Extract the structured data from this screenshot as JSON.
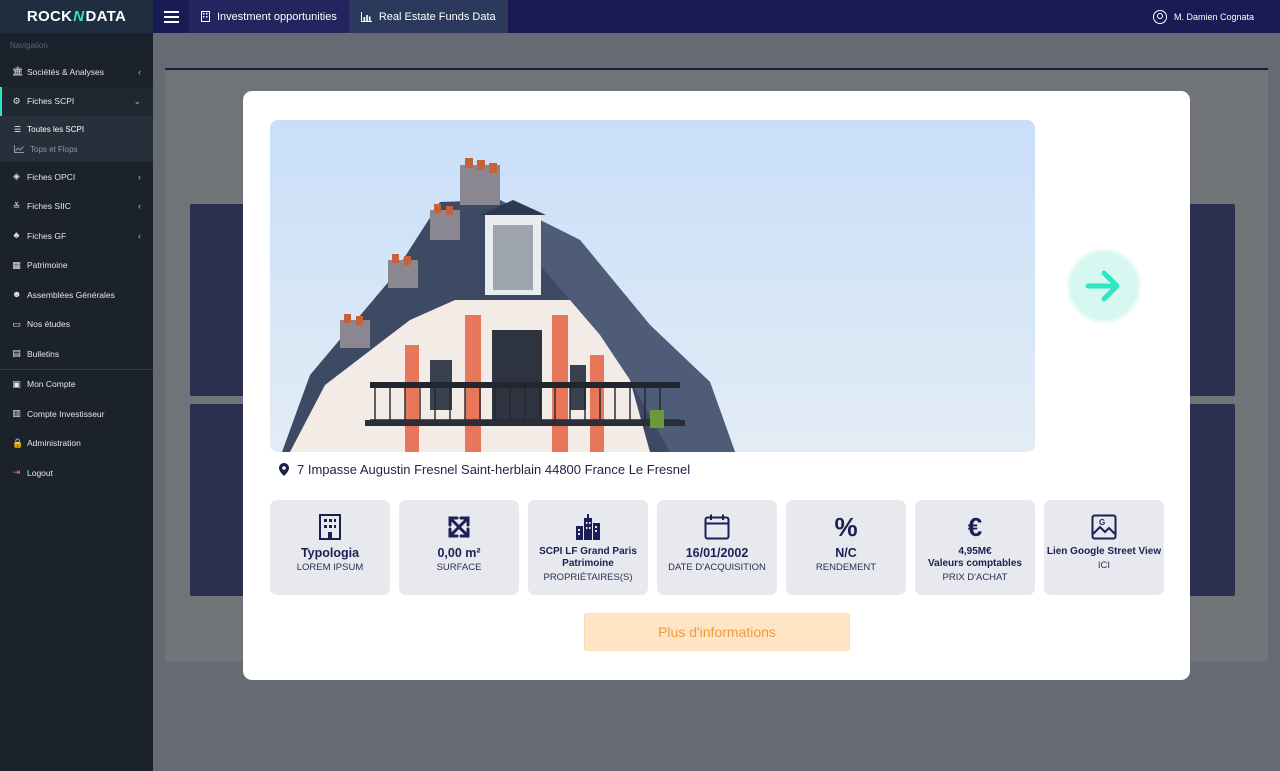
{
  "brand": {
    "left": "ROCK",
    "mid": "N",
    "right": "DATA"
  },
  "topnav": {
    "items": [
      {
        "label": "Investment opportunities",
        "icon": "building-icon"
      },
      {
        "label": "Real Estate Funds Data",
        "icon": "chart-icon"
      }
    ],
    "user": "M. Damien Cognata"
  },
  "sidebar": {
    "section_label": "Navigation",
    "items": [
      {
        "label": "Sociétés & Analyses",
        "icon": "bank-icon",
        "chevron": "‹"
      },
      {
        "label": "Fiches SCPI",
        "icon": "sitemap-icon",
        "chevron": "⌄"
      },
      {
        "label": "Fiches OPCI",
        "icon": "cubes-icon",
        "chevron": "‹"
      },
      {
        "label": "Fiches SIIC",
        "icon": "sliders-icon",
        "chevron": "‹"
      },
      {
        "label": "Fiches GF",
        "icon": "tree-icon",
        "chevron": "‹"
      },
      {
        "label": "Patrimoine",
        "icon": "building-icon"
      },
      {
        "label": "Assemblées Générales",
        "icon": "users-icon"
      },
      {
        "label": "Nos études",
        "icon": "laptop-icon"
      },
      {
        "label": "Bulletins",
        "icon": "book-icon"
      },
      {
        "label": "Mon Compte",
        "icon": "id-card-icon"
      },
      {
        "label": "Compte Investisseur",
        "icon": "bar-chart-icon"
      },
      {
        "label": "Administration",
        "icon": "lock-icon"
      },
      {
        "label": "Logout",
        "icon": "sign-out-icon"
      }
    ],
    "subitems": [
      {
        "label": "Toutes les SCPI",
        "icon": "list-icon"
      },
      {
        "label": "Tops et Flops",
        "icon": "line-chart-icon"
      }
    ]
  },
  "modal": {
    "address": "7 Impasse Augustin Fresnel Saint-herblain 44800 France Le Fresnel",
    "cards": [
      {
        "value": "Typologia",
        "label": "LOREM IPSUM",
        "icon": "building-icon"
      },
      {
        "value": "0,00 m²",
        "label": "SURFACE",
        "icon": "expand-icon"
      },
      {
        "value": "SCPI LF Grand Paris Patrimoine",
        "label": "PROPRIÉTAIRES(S)",
        "icon": "city-icon"
      },
      {
        "value": "16/01/2002",
        "label": "DATE D'ACQUISITION",
        "icon": "calendar-icon"
      },
      {
        "value": "N/C",
        "label": "RENDEMENT",
        "icon": "percent-icon"
      },
      {
        "value_line1": "4,95M€",
        "value_line2": "Valeurs comptables",
        "label": "PRIX D'ACHAT",
        "icon": "euro-icon"
      },
      {
        "value": "Lien Google Street View",
        "label": "ICI",
        "icon": "map-image-icon"
      }
    ],
    "more_button": "Plus d'informations"
  },
  "colors": {
    "accent": "#2fe6c4",
    "navy": "#1c1f55",
    "orange": "#f29a3b"
  }
}
